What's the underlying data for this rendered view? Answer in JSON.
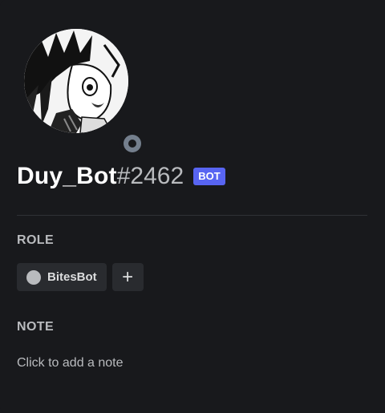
{
  "profile": {
    "username": "Duy_Bot",
    "discriminator": "#2462",
    "bot_tag": "BOT",
    "avatar_icon": "anime-avatar-icon",
    "status_icon": "offline-status-icon"
  },
  "role_section": {
    "title": "ROLE",
    "roles": [
      {
        "name": "BitesBot",
        "color": "#b9bbbe"
      }
    ],
    "add_label": "+"
  },
  "note_section": {
    "title": "NOTE",
    "placeholder": "Click to add a note"
  },
  "colors": {
    "background": "#18191c",
    "bot_tag": "#5865f2",
    "status_offline": "#747f8d"
  }
}
